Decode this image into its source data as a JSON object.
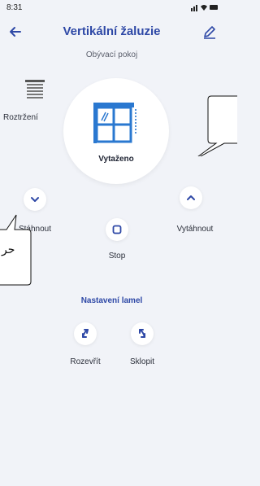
{
  "status": {
    "time": "8:31"
  },
  "header": {
    "title": "Vertikální žaluzie",
    "subtitle": "Obývací pokoj"
  },
  "device": {
    "state": "Vytaženo"
  },
  "actions": {
    "roztrzeni": "Roztržení",
    "down": "Stáhnout",
    "up": "Vytáhnout",
    "stop": "Stop"
  },
  "lamels": {
    "title": "Nastavení lamel",
    "open": "Rozevřít",
    "tilt": "Sklopit"
  },
  "overlay": {
    "callout_text": "حر"
  },
  "colors": {
    "accent": "#2e48a6",
    "icon_blue": "#2a78d0",
    "background": "#f1f3f8"
  }
}
